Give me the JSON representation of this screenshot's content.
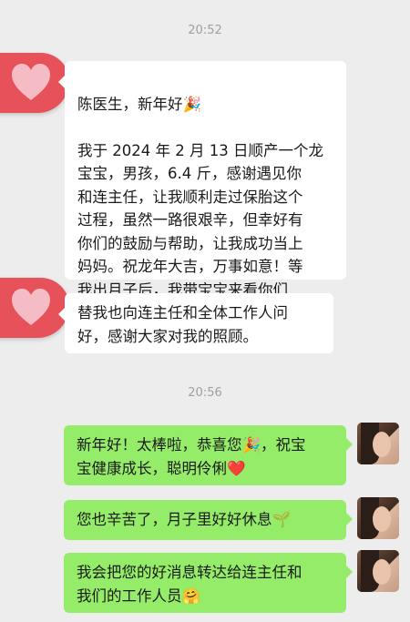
{
  "chat": {
    "time1": "20:52",
    "time2": "20:56",
    "msg1_line1": "陈医生，新年好🎉",
    "msg1_body": "我于 2024 年 2 月 13 日顺产一个龙\n宝宝，男孩，6.4 斤，感谢遇见你\n和连主任，让我顺利走过保胎这个\n过程，虽然一路很艰辛，但幸好有\n你们的鼓励与帮助，让我成功当上\n妈妈。祝龙年大吉，万事如意！等\n我出月子后，我带宝宝来看你们\n哈。",
    "msg2": "替我也向连主任和全体工作人问\n好，感谢大家对我的照顾。",
    "msg3": "新年好！太棒啦，恭喜您🎉，祝宝\n宝健康成长，聪明伶俐❤️",
    "msg4": "您也辛苦了，月子里好好休息🌱",
    "msg5": "我会把您的好消息转达给连主任和\n我们的工作人员🤗"
  },
  "icons": {
    "sender_avatar": "heart-icon",
    "receiver_avatar": "person-photo-avatar"
  },
  "colors": {
    "background": "#ededed",
    "incoming_bubble": "#ffffff",
    "outgoing_bubble": "#95ec69",
    "avatar_red": "#e7525a"
  }
}
